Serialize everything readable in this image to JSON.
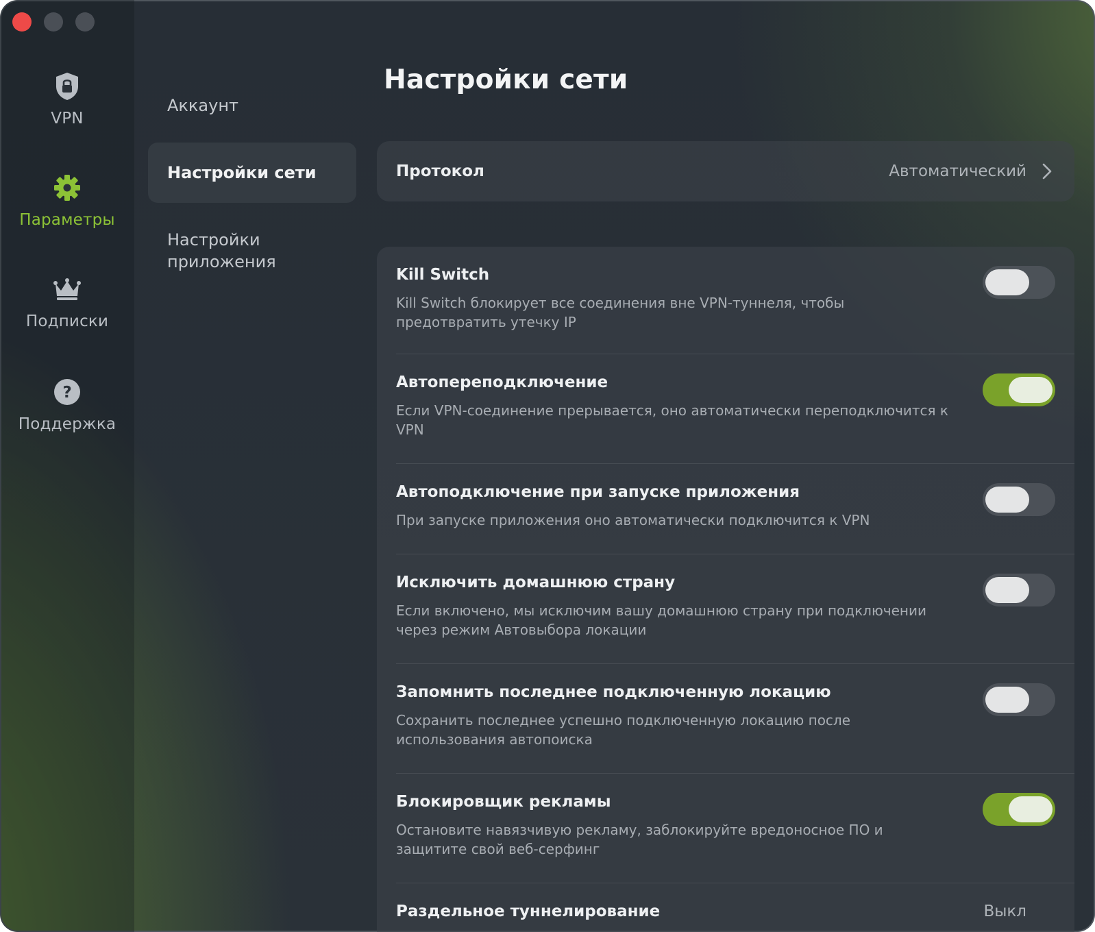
{
  "window": {
    "controls": [
      "close",
      "minimize",
      "zoom"
    ]
  },
  "sidebar": {
    "items": [
      {
        "label": "VPN",
        "icon": "shield-lock-icon",
        "active": false
      },
      {
        "label": "Параметры",
        "icon": "gear-icon",
        "active": true
      },
      {
        "label": "Подписки",
        "icon": "crown-icon",
        "active": false
      },
      {
        "label": "Поддержка",
        "icon": "question-icon",
        "active": false
      }
    ],
    "accent_color": "#8cc236"
  },
  "submenu": {
    "items": [
      {
        "label": "Аккаунт",
        "active": false
      },
      {
        "label": "Настройки сети",
        "active": true
      },
      {
        "label": "Настройки приложения",
        "active": false
      }
    ]
  },
  "main": {
    "title": "Настройки сети",
    "protocol": {
      "label": "Протокол",
      "value": "Автоматический"
    },
    "settings": [
      {
        "title": "Kill Switch",
        "description": "Kill Switch блокирует все соединения вне VPN-туннеля, чтобы предотвратить утечку IP",
        "enabled": false
      },
      {
        "title": "Автопереподключение",
        "description": "Если VPN-соединение прерывается, оно автоматически переподключится к VPN",
        "enabled": true
      },
      {
        "title": "Автоподключение при запуске приложения",
        "description": "При запуске приложения оно автоматически подключится к VPN",
        "enabled": false
      },
      {
        "title": "Исключить домашнюю страну",
        "description": "Если включено, мы исключим вашу домашнюю страну при подключении через режим Автовыбора локации",
        "enabled": false
      },
      {
        "title": "Запомнить последнее подключенную локацию",
        "description": "Сохранить последнее успешно подключенную локацию после использования автопоиска",
        "enabled": false
      },
      {
        "title": "Блокировщик рекламы",
        "description": "Остановите навязчивую рекламу, заблокируйте вредоносное ПО и защитите свой веб-серфинг",
        "enabled": true
      }
    ],
    "split_tunneling": {
      "title": "Раздельное туннелирование",
      "value": "Выкл"
    },
    "toggle_on_color": "#7aa22a"
  }
}
